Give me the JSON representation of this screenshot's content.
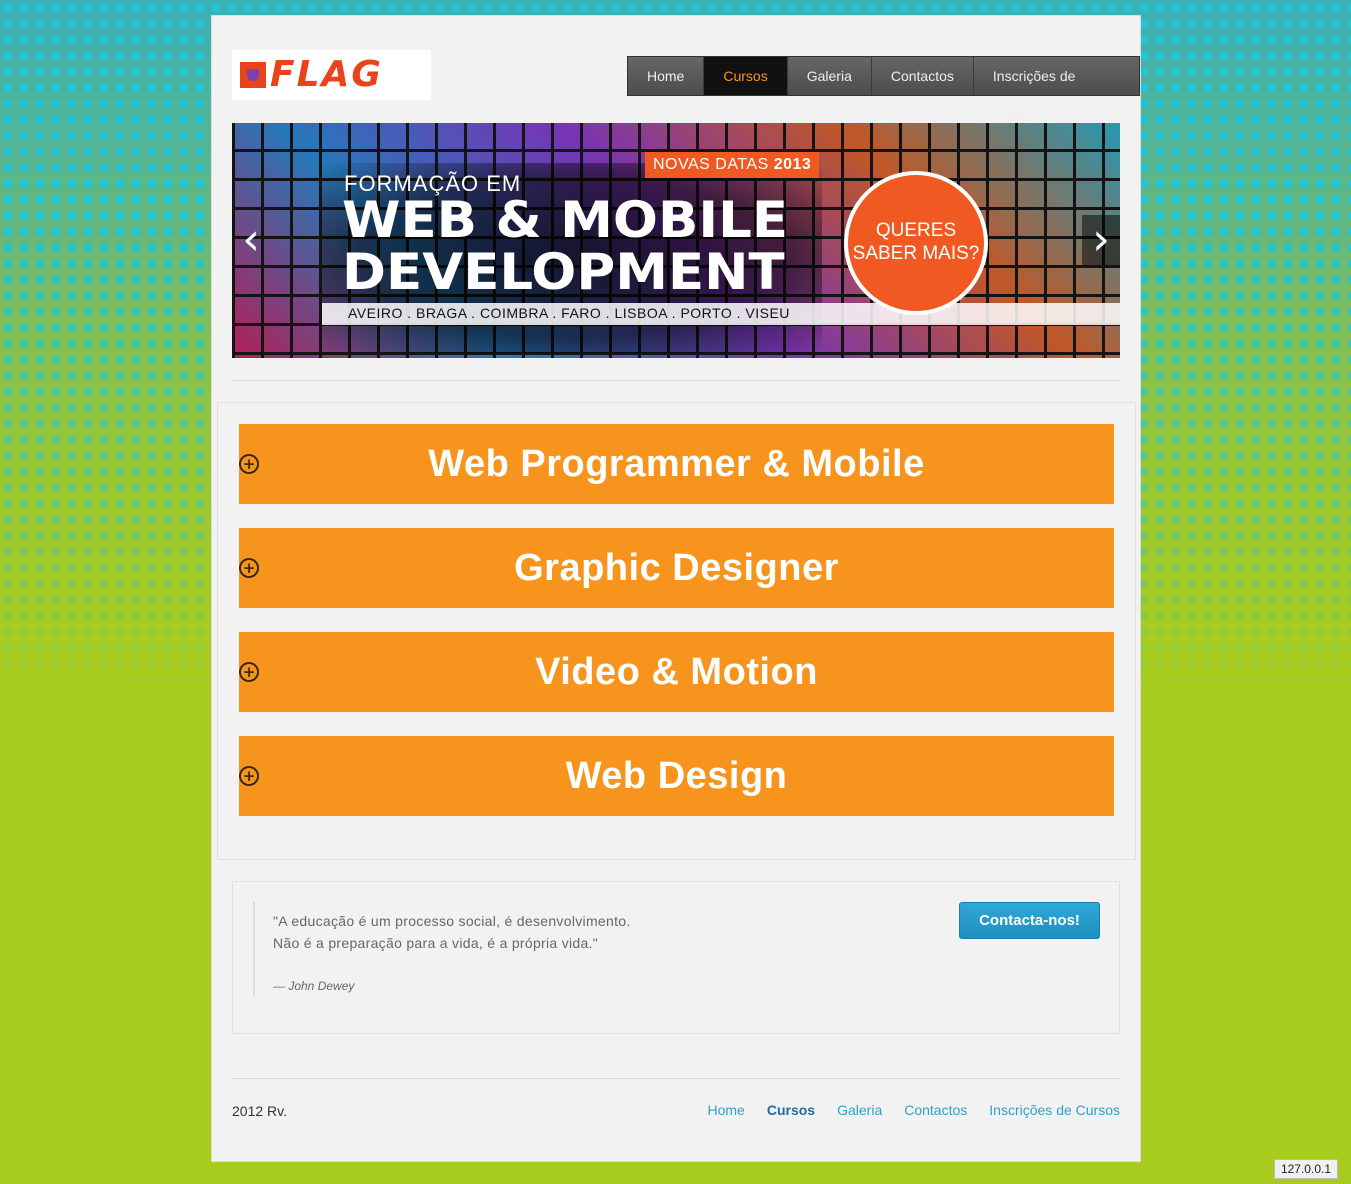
{
  "brand": {
    "logo_text": "FLAG",
    "accent": "#f05a22",
    "orange": "#f7941d",
    "link": "#2fa0cc"
  },
  "topnav": [
    {
      "label": "Home",
      "active": false
    },
    {
      "label": "Cursos",
      "active": true
    },
    {
      "label": "Galeria",
      "active": false
    },
    {
      "label": "Contactos",
      "active": false
    },
    {
      "label": "Inscrições de Cursos",
      "active": false
    }
  ],
  "banner": {
    "badge_prefix": "NOVAS DATAS",
    "badge_year": "2013",
    "line1": "FORMAÇÃO EM",
    "line2": "WEB & MOBILE",
    "line3": "DEVELOPMENT",
    "cities": "AVEIRO . BRAGA . COIMBRA . FARO . LISBOA . PORTO . VISEU",
    "circle_line1": "QUERES",
    "circle_line2": "SABER MAIS?",
    "prev_icon": "‹",
    "next_icon": "›"
  },
  "courses": [
    {
      "title": "Web Programmer & Mobile",
      "icon": "plus-circle-icon"
    },
    {
      "title": "Graphic Designer",
      "icon": "plus-circle-icon"
    },
    {
      "title": "Video & Motion",
      "icon": "plus-circle-icon"
    },
    {
      "title": "Web Design",
      "icon": "plus-circle-icon"
    }
  ],
  "quote": {
    "line1": "\"A educação é um processo social, é desenvolvimento.",
    "line2": "Não é a preparação para a vida, é a própria vida.\"",
    "author": "— John Dewey",
    "cta_label": "Contacta-nos!"
  },
  "footer": {
    "copyright": "2012 Rv.",
    "links": [
      {
        "label": "Home",
        "active": false
      },
      {
        "label": "Cursos",
        "active": true
      },
      {
        "label": "Galeria",
        "active": false
      },
      {
        "label": "Contactos",
        "active": false
      },
      {
        "label": "Inscrições de Cursos",
        "active": false
      }
    ]
  },
  "status_host": "127.0.0.1"
}
